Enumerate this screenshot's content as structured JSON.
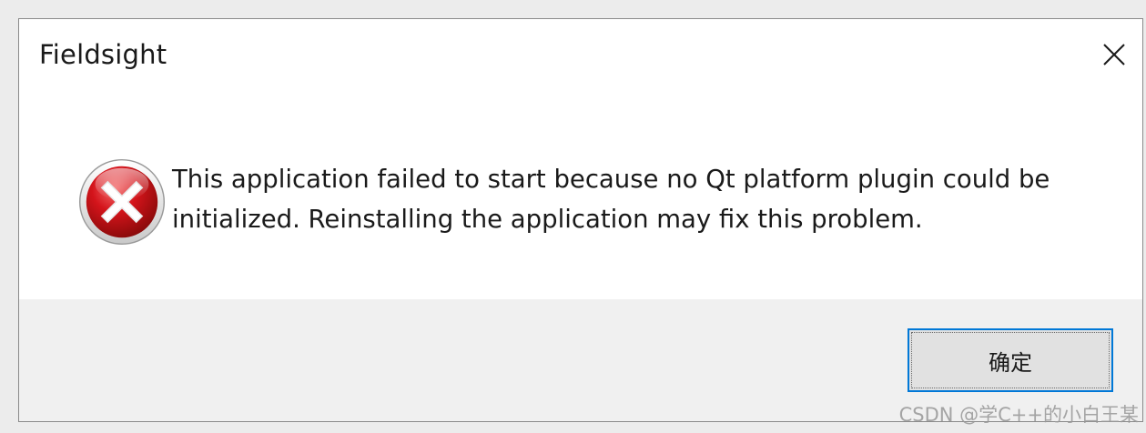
{
  "dialog": {
    "title": "Fieldsight",
    "message": "This application failed to start because no Qt platform plugin could be initialized. Reinstalling the application may fix this problem.",
    "icon": "error-icon",
    "close_icon": "close-icon",
    "ok_label": "确定",
    "accent_color": "#0078d7",
    "error_color": "#c8102e"
  },
  "watermark": {
    "text": "CSDN @学C++的小白王某"
  }
}
